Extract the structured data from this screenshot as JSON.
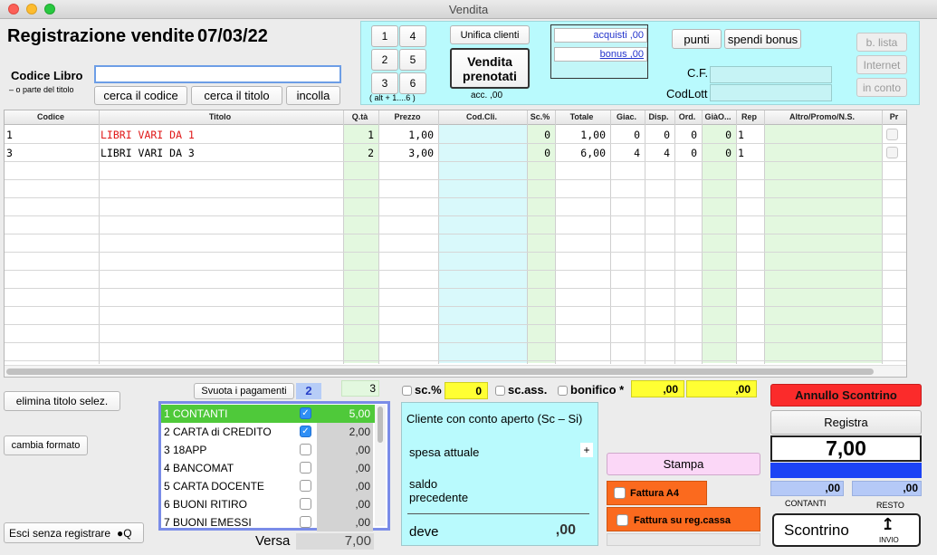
{
  "window": {
    "title": "Vendita"
  },
  "header": {
    "title": "Registrazione vendite",
    "date": "07/03/22",
    "codice_label": "Codice Libro",
    "codice_sub": "– o parte del  titolo",
    "codice_value": "",
    "btn_cerca_codice": "cerca il codice",
    "btn_cerca_titolo": "cerca il titolo",
    "btn_incolla": "incolla"
  },
  "quick": {
    "keys": [
      "1",
      "4",
      "2",
      "5",
      "3",
      "6"
    ],
    "hint": "( alt + 1....6 )",
    "btn_unifica": "Unifica clienti",
    "btn_vendita_prenotati": "Vendita prenotati",
    "acc_value": "acc. ,00",
    "acquisti": "acquisti ,00",
    "bonus": "bonus ,00",
    "btn_punti": "punti",
    "btn_spendi_bonus": "spendi bonus",
    "cf_label": "C.F.",
    "codlott_label": "CodLott",
    "btn_b_lista": "b. lista",
    "btn_internet": "Internet",
    "btn_in_conto": "in conto"
  },
  "table": {
    "columns": [
      "Codice",
      "Titolo",
      "Q.tà",
      "Prezzo",
      "Cod.Cli.",
      "Sc.%",
      "Totale",
      "Giac.",
      "Disp.",
      "Ord.",
      "GiàO...",
      "Rep",
      "Altro/Promo/N.S.",
      "Pr"
    ],
    "rows": [
      {
        "codice": "1",
        "titolo": "LIBRI VARI DA 1",
        "qta": "1",
        "prezzo": "1,00",
        "codcli": "",
        "sc": "0",
        "totale": "1,00",
        "giac": "0",
        "disp": "0",
        "ord": "0",
        "giao": "0",
        "rep": "1",
        "altro": ""
      },
      {
        "codice": "3",
        "titolo": "LIBRI VARI DA 3",
        "qta": "2",
        "prezzo": "3,00",
        "codcli": "",
        "sc": "0",
        "totale": "6,00",
        "giac": "4",
        "disp": "4",
        "ord": "0",
        "giao": "0",
        "rep": "1",
        "altro": ""
      }
    ]
  },
  "left_actions": {
    "elimina": "elimina titolo selez.",
    "cambia_formato": "cambia formato",
    "esci": "Esci senza registrare"
  },
  "payments": {
    "svuota": "Svuota i pagamenti",
    "count_blue": "2",
    "count_green": "3",
    "items": [
      {
        "label": "1 CONTANTI",
        "checked": true,
        "value": "5,00",
        "selected": true
      },
      {
        "label": "2 CARTA di CREDITO",
        "checked": true,
        "value": "2,00",
        "selected": false
      },
      {
        "label": "3 18APP",
        "checked": false,
        "value": ",00",
        "selected": false
      },
      {
        "label": "4 BANCOMAT",
        "checked": false,
        "value": ",00",
        "selected": false
      },
      {
        "label": "5 CARTA DOCENTE",
        "checked": false,
        "value": ",00",
        "selected": false
      },
      {
        "label": "6 BUONI RITIRO",
        "checked": false,
        "value": ",00",
        "selected": false
      },
      {
        "label": "7 BUONI EMESSI",
        "checked": false,
        "value": ",00",
        "selected": false
      }
    ],
    "versa_label": "Versa",
    "versa_value": "7,00"
  },
  "discounts": {
    "sc_label": "sc.%",
    "sc_value": "0",
    "scass_label": "sc.ass.",
    "bonifico_label": "bonifico *",
    "yellow1": ",00",
    "yellow2": ",00"
  },
  "cliente_panel": {
    "title": "Cliente con conto aperto (Sc – Si)",
    "spesa": "spesa attuale",
    "plus": "+",
    "saldo": "saldo precedente",
    "deve_label": "deve",
    "deve_value": ",00"
  },
  "right_actions": {
    "annullo": "Annullo Scontrino",
    "registra": "Registra",
    "total": "7,00",
    "stampa": "Stampa",
    "fattura_a4": "Fattura A4",
    "fattura_reg": "Fattura su reg.cassa",
    "contanti_value": ",00",
    "resto_value": ",00",
    "contanti_label": "CONTANTI",
    "resto_label": "RESTO",
    "scontrino": "Scontrino",
    "invio": "INVIO"
  },
  "colors": {
    "red_button": "#fb2b2b",
    "blue_bar": "#1c43f5",
    "cyan": "#b9fafd",
    "green_col": "#e3f8df",
    "selected_row": "#4fc93a"
  }
}
